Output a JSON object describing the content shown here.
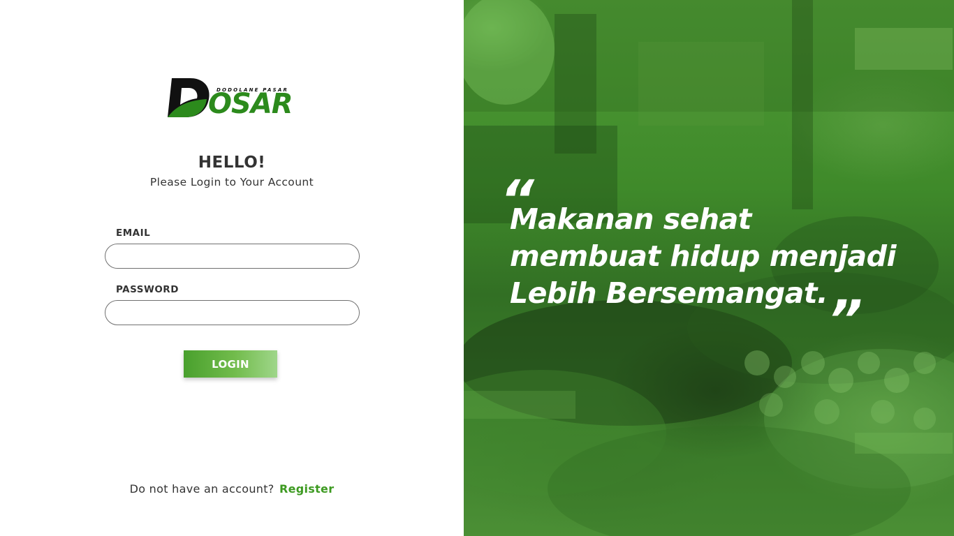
{
  "brand": {
    "tagline": "DODOLANE PASAR",
    "wordmark": "OSAR",
    "letter": "D",
    "primary_color": "#2c8a1c",
    "dark_color": "#111111"
  },
  "login": {
    "title": "HELLO!",
    "subtitle": "Please Login to Your Account",
    "email_label": "EMAIL",
    "email_value": "",
    "password_label": "PASSWORD",
    "password_value": "",
    "button_label": "LOGIN",
    "button_color": "#5aad3a"
  },
  "footer": {
    "prompt": "Do not have an account?",
    "register_label": "Register",
    "register_color": "#3d9a21"
  },
  "hero": {
    "open_quote": "“",
    "close_quote": "”",
    "lines": [
      "Makanan sehat",
      "membuat hidup menjadi",
      "Lebih Bersemangat."
    ],
    "overlay_color": "#4a9a34"
  }
}
